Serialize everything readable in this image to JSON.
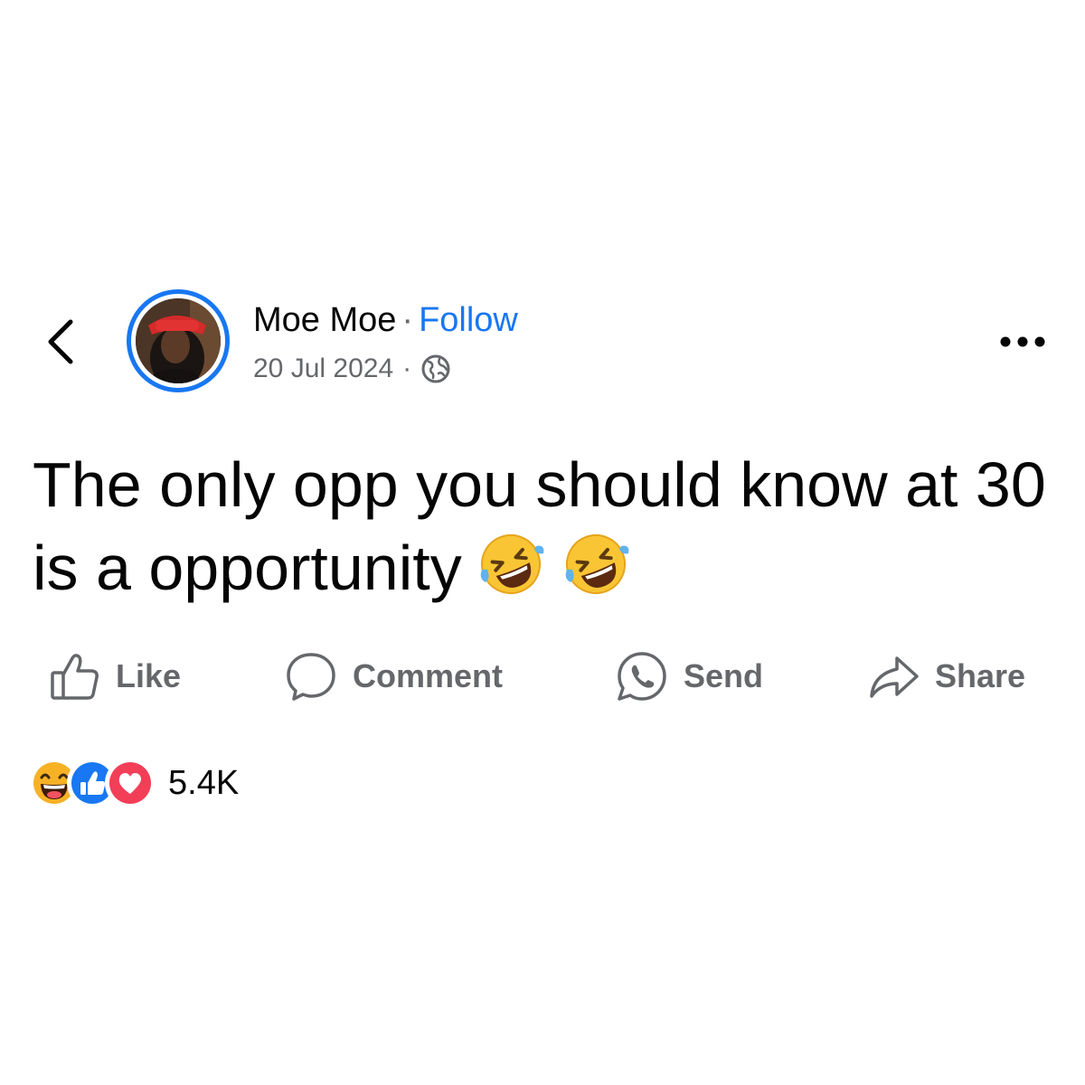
{
  "header": {
    "back_icon": "chevron-left-icon",
    "author_name": "Moe Moe",
    "separator": "·",
    "follow_label": "Follow",
    "timestamp": "20 Jul 2024",
    "meta_separator": "·",
    "audience_icon": "globe-icon",
    "more_icon": "more-dots-icon"
  },
  "post": {
    "text": "The only opp you should know at 30 is a opportunity",
    "emojis": [
      "rolling-on-floor-laughing-emoji",
      "rolling-on-floor-laughing-emoji"
    ]
  },
  "actions": [
    {
      "label": "Like",
      "icon": "thumbs-up-outline-icon"
    },
    {
      "label": "Comment",
      "icon": "speech-bubble-icon"
    },
    {
      "label": "Send",
      "icon": "whatsapp-icon"
    },
    {
      "label": "Share",
      "icon": "share-arrow-icon"
    }
  ],
  "reactions": {
    "icons": [
      "haha-reaction-icon",
      "like-reaction-icon",
      "love-reaction-icon"
    ],
    "count": "5.4K"
  },
  "colors": {
    "accent": "#1877f2",
    "secondary_text": "#65676b",
    "primary_text": "#050505",
    "love": "#f33e58",
    "haha": "#f7b125"
  }
}
